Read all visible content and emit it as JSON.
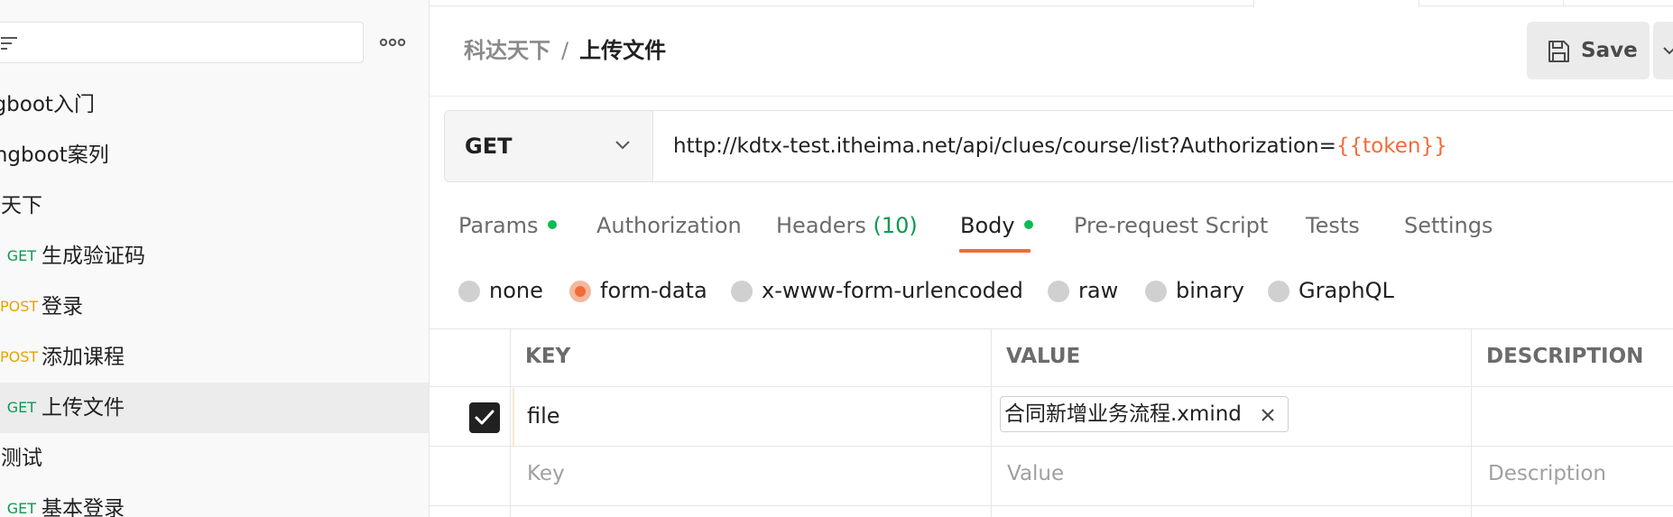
{
  "sidebar": {
    "more_icon": "more-horizontal-icon",
    "filter_icon": "filter-icon",
    "items": [
      {
        "kind": "folder",
        "name": "ngboot入门"
      },
      {
        "kind": "folder",
        "name": "ringboot案列"
      },
      {
        "kind": "folder",
        "name": "达天下"
      },
      {
        "kind": "request",
        "method": "GET",
        "name": "生成验证码"
      },
      {
        "kind": "request",
        "method": "POST",
        "name": "登录"
      },
      {
        "kind": "request",
        "method": "POST",
        "name": "添加课程"
      },
      {
        "kind": "request",
        "method": "GET",
        "name": "上传文件",
        "selected": true
      },
      {
        "kind": "folder",
        "name": "件测试"
      },
      {
        "kind": "request",
        "method": "GET",
        "name": "基本登录"
      }
    ]
  },
  "header": {
    "breadcrumb_parent": "科达天下",
    "breadcrumb_separator": "/",
    "breadcrumb_current": "上传文件",
    "save_label": "Save",
    "save_icon": "save-disk-icon"
  },
  "request": {
    "method": "GET",
    "url_base": "http://kdtx-test.itheima.net/api/clues/course/list?Authorization=",
    "url_variable": "{{token}}"
  },
  "tabs": {
    "params": "Params",
    "authorization": "Authorization",
    "headers": "Headers",
    "headers_count": "(10)",
    "body": "Body",
    "prerequest": "Pre-request Script",
    "tests": "Tests",
    "settings": "Settings",
    "active": "Body"
  },
  "body_types": {
    "none": "none",
    "form_data": "form-data",
    "urlencoded": "x-www-form-urlencoded",
    "raw": "raw",
    "binary": "binary",
    "graphql": "GraphQL",
    "selected": "form-data"
  },
  "table": {
    "headers": {
      "key": "KEY",
      "value": "VALUE",
      "description": "DESCRIPTION"
    },
    "rows": [
      {
        "checked": true,
        "key": "file",
        "value_file": "合同新增业务流程.xmind",
        "description": ""
      }
    ],
    "placeholders": {
      "key": "Key",
      "value": "Value",
      "description": "Description"
    }
  },
  "colors": {
    "accent": "#f26b3a",
    "get_method": "#0a9a4e",
    "post_method": "#e5a400",
    "status_dot": "#0cbb52"
  }
}
